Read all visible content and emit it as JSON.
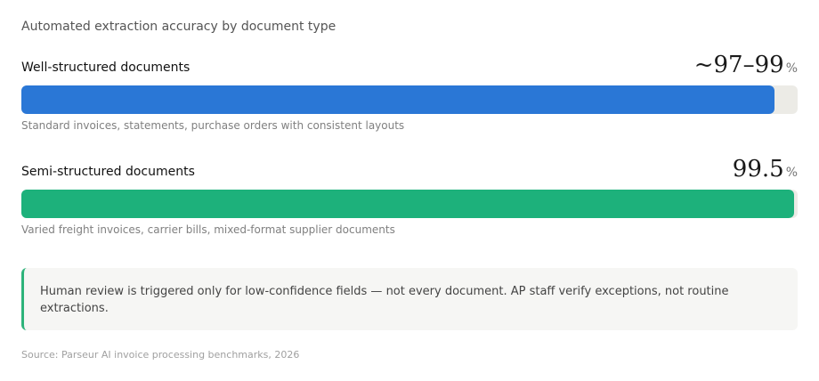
{
  "chart_data": {
    "type": "bar",
    "orientation": "horizontal",
    "title": "Automated extraction accuracy by document type",
    "unit": "%",
    "xlim": [
      0,
      100
    ],
    "grid": false,
    "series": [
      {
        "label": "Well-structured documents",
        "value_text": "~97–99",
        "value": 97,
        "value_range": [
          97,
          99
        ],
        "description": "Standard invoices, statements, purchase orders with consistent layouts",
        "color": "#2a77d6"
      },
      {
        "label": "Semi-structured documents",
        "value_text": "99.5",
        "value": 99.5,
        "description": "Varied freight invoices, carrier bills, mixed-format supplier documents",
        "color": "#1db17b"
      }
    ]
  },
  "note": {
    "text": "Human review is triggered only for low-confidence fields — not every document. AP staff verify exceptions, not routine extractions.",
    "accent_color": "#2db37a"
  },
  "source": "Source: Parseur AI invoice processing benchmarks, 2026"
}
